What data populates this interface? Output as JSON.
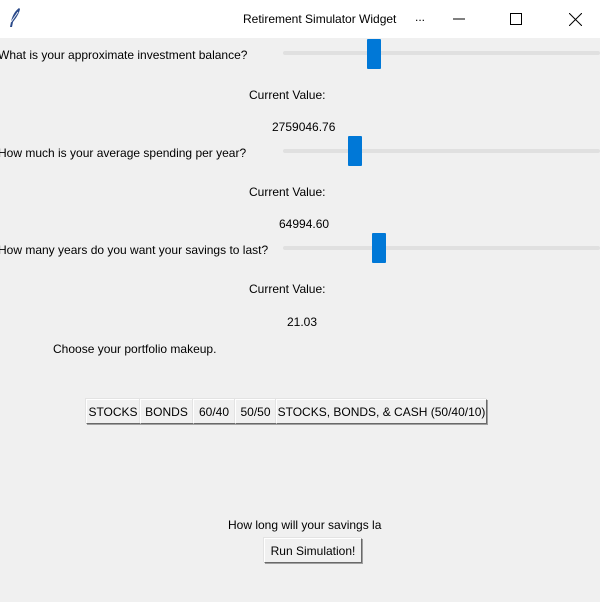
{
  "window": {
    "title": "Retirement Simulator Widget",
    "title_ellipsis": "...",
    "accent_color": "#0078d7"
  },
  "questions": [
    {
      "label": "What is your approximate investment balance?",
      "current_value_label": "Current Value:",
      "value": "2759046.76"
    },
    {
      "label": "How much is your average spending per year?",
      "current_value_label": "Current Value:",
      "value": "64994.60"
    },
    {
      "label": "How many years do you want your savings to last?",
      "current_value_label": "Current Value:",
      "value": "21.03"
    }
  ],
  "portfolio": {
    "prompt": "Choose your portfolio makeup.",
    "options": [
      "STOCKS",
      "BONDS",
      "60/40",
      "50/50",
      "STOCKS, BONDS, & CASH (50/40/10)"
    ]
  },
  "result": {
    "label": "How long will your savings la",
    "run_button": "Run Simulation!"
  }
}
